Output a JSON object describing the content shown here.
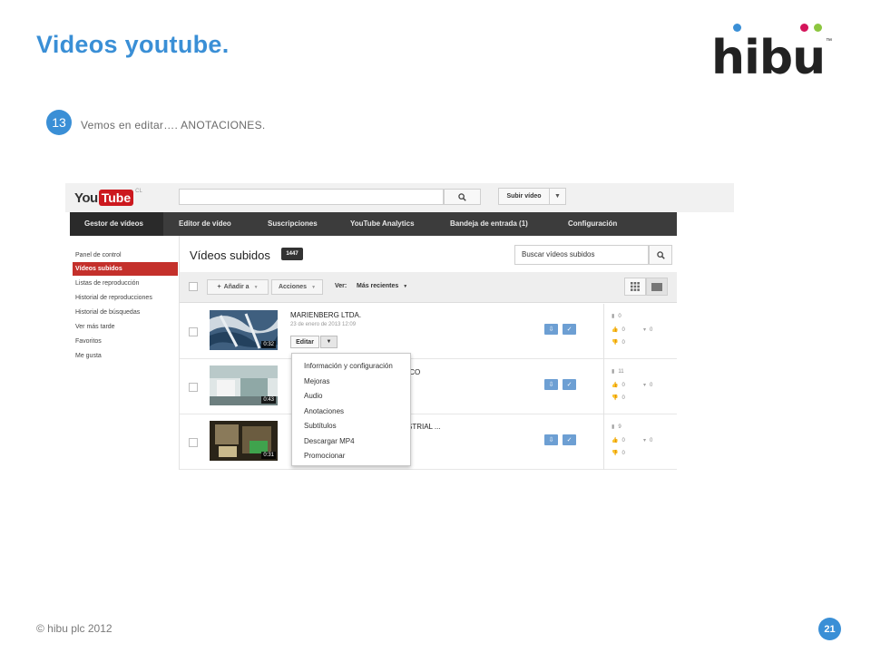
{
  "slide": {
    "title": "Videos youtube.",
    "logo_text": "hibu",
    "logo_tm": "™",
    "step_number": "13",
    "step_text": "Vemos en editar…. ANOTACIONES.",
    "footer": "© hibu plc 2012",
    "page_number": "21",
    "accent_color": "#3a8fd6",
    "logo_dot_colors": [
      "#3a8fd6",
      "#d4145a",
      "#8cc63f"
    ]
  },
  "youtube": {
    "logo_you": "You",
    "logo_tube": "Tube",
    "logo_country": "CL",
    "search_icon": "search-icon",
    "upload_label": "Subir vídeo",
    "nav": [
      "Gestor de vídeos",
      "Editor de vídeo",
      "Suscripciones",
      "YouTube Analytics",
      "Bandeja de entrada (1)",
      "Configuración"
    ],
    "sidebar": [
      "Panel de control",
      "Vídeos subidos",
      "Listas de reproducción",
      "Historial de reproducciones",
      "Historial de búsquedas",
      "Ver más tarde",
      "Favoritos",
      "Me gusta"
    ],
    "page_title": "Vídeos subidos",
    "video_count": "1447",
    "search_placeholder": "Buscar vídeos subidos",
    "toolbar": {
      "add_to": "Añadir a",
      "actions": "Acciones",
      "view_label": "Ver:",
      "sort": "Más recientes"
    },
    "videos": [
      {
        "title": "MARIENBERG LTDA.",
        "date": "23 de enero de 2013 12:09",
        "duration": "0:32",
        "views": "0",
        "likes": "0",
        "dislikes": "0",
        "comments": "0"
      },
      {
        "title_fragment": "ICO",
        "duration": "0:43",
        "views": "11",
        "likes": "0",
        "dislikes": "0",
        "comments": "0"
      },
      {
        "title_fragment": "STRIAL ...",
        "duration": "0:31",
        "views": "9",
        "likes": "0",
        "dislikes": "0",
        "comments": "0"
      }
    ],
    "edit_label": "Editar",
    "edit_menu": [
      "Información y configuración",
      "Mejoras",
      "Audio",
      "Anotaciones",
      "Subtítulos",
      "Descargar MP4",
      "Promocionar"
    ],
    "brand_red": "#cc181e",
    "nav_bg": "#3c3c3c"
  }
}
